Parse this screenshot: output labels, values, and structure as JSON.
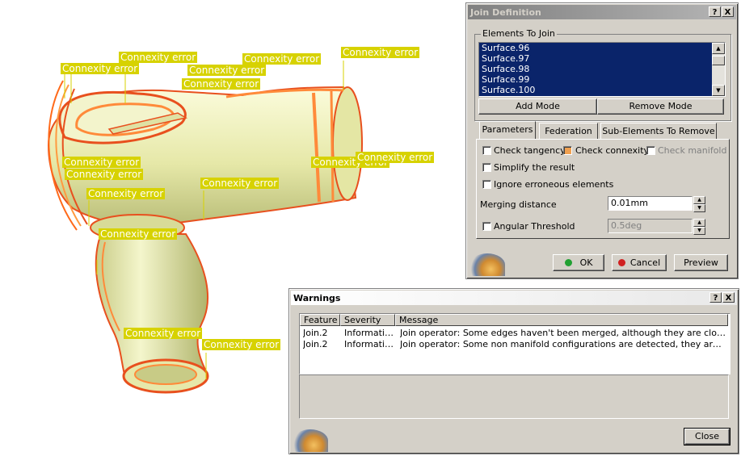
{
  "viewport": {
    "connexity_label": "Connexity error",
    "label_color": "#d7d200",
    "curve_color": "#e8501e",
    "surface_color": "#eef0b8"
  },
  "join_dialog": {
    "title": "Join Definition",
    "help_btn": "?",
    "close_btn": "X",
    "elements_group_label": "Elements To Join",
    "elements": [
      "Surface.96",
      "Surface.97",
      "Surface.98",
      "Surface.99",
      "Surface.100"
    ],
    "add_mode": "Add Mode",
    "remove_mode": "Remove Mode",
    "tabs": [
      "Parameters",
      "Federation",
      "Sub-Elements To Remove"
    ],
    "check_tangency": "Check tangency",
    "check_connexity": "Check connexity",
    "check_manifold": "Check manifold",
    "simplify_result": "Simplify the result",
    "ignore_erroneous": "Ignore erroneous elements",
    "merging_distance_label": "Merging distance",
    "merging_distance_value": "0.01mm",
    "angular_threshold_label": "Angular Threshold",
    "angular_threshold_value": "0.5deg",
    "ok": "OK",
    "cancel": "Cancel",
    "preview": "Preview"
  },
  "warnings_dialog": {
    "title": "Warnings",
    "help_btn": "?",
    "close_btn": "X",
    "columns": [
      "Feature",
      "Severity",
      "Message"
    ],
    "rows": [
      {
        "feature": "Join.2",
        "severity": "Information",
        "message": "Join operator: Some edges haven't been merged, although they are closer than ..."
      },
      {
        "feature": "Join.2",
        "severity": "Information",
        "message": "Join operator: Some non manifold configurations are detected, they are not man..."
      }
    ],
    "close": "Close"
  }
}
